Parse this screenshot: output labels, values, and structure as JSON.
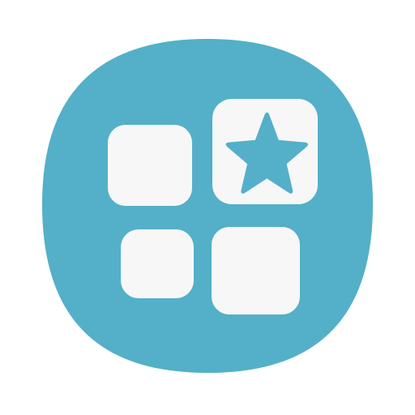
{
  "icon": {
    "name": "apps-favorites-icon",
    "background_color": "#53b0c8",
    "tile_color": "#f7f7f7",
    "star_color": "#53b0c8",
    "tiles": [
      {
        "name": "app-tile-top-left"
      },
      {
        "name": "app-tile-favorite"
      },
      {
        "name": "app-tile-bottom-left"
      },
      {
        "name": "app-tile-bottom-right"
      }
    ],
    "star_icon_name": "star-icon"
  }
}
